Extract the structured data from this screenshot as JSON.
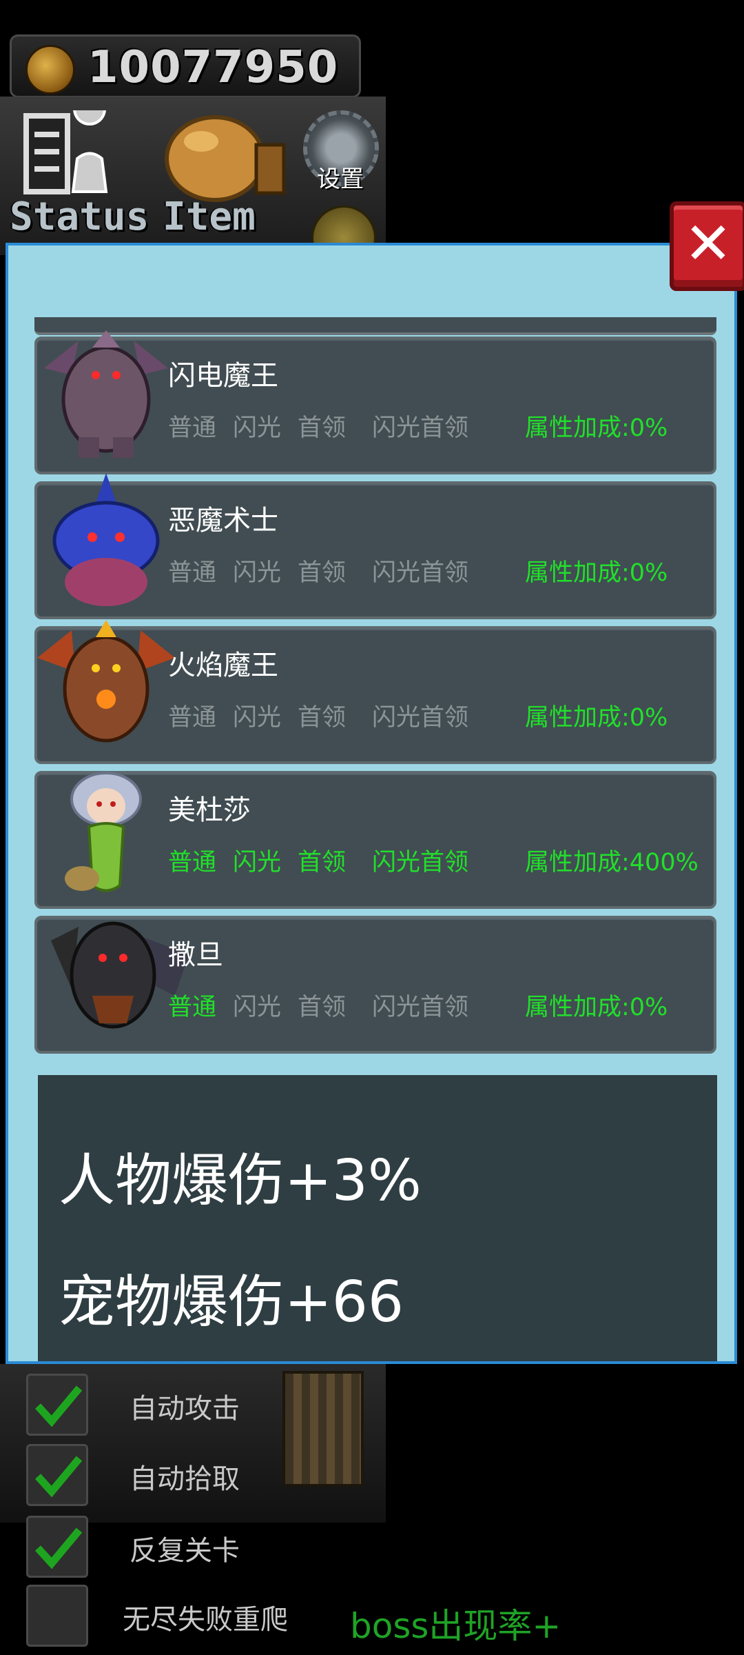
{
  "hud": {
    "coins": "10077950",
    "status_label": "Status",
    "item_label": "Item",
    "settings_label": "设置"
  },
  "close_symbol": "✕",
  "monsters": [
    {
      "name": "闪电魔王",
      "tiers": [
        "普通",
        "闪光",
        "首领",
        "闪光首领"
      ],
      "active": [
        false,
        false,
        false,
        false
      ],
      "bonus": "属性加成:0%"
    },
    {
      "name": "恶魔术士",
      "tiers": [
        "普通",
        "闪光",
        "首领",
        "闪光首领"
      ],
      "active": [
        false,
        false,
        false,
        false
      ],
      "bonus": "属性加成:0%"
    },
    {
      "name": "火焰魔王",
      "tiers": [
        "普通",
        "闪光",
        "首领",
        "闪光首领"
      ],
      "active": [
        false,
        false,
        false,
        false
      ],
      "bonus": "属性加成:0%"
    },
    {
      "name": "美杜莎",
      "tiers": [
        "普通",
        "闪光",
        "首领",
        "闪光首领"
      ],
      "active": [
        true,
        true,
        true,
        true
      ],
      "bonus": "属性加成:400%"
    },
    {
      "name": "撒旦",
      "tiers": [
        "普通",
        "闪光",
        "首领",
        "闪光首领"
      ],
      "active": [
        true,
        false,
        false,
        false
      ],
      "bonus": "属性加成:0%"
    }
  ],
  "stats": {
    "line1": "人物爆伤+3%",
    "line2": "宠物爆伤+66"
  },
  "toggles": [
    {
      "label": "自动攻击",
      "checked": true
    },
    {
      "label": "自动拾取",
      "checked": true
    },
    {
      "label": "反复关卡",
      "checked": true
    },
    {
      "label": "无尽失败重爬",
      "checked": false
    }
  ],
  "boss_rate": "boss出现率+",
  "colors": {
    "active": "#21e02a",
    "inactive": "#8c9498",
    "panel": "#9dd7e6",
    "card": "#414d52"
  }
}
